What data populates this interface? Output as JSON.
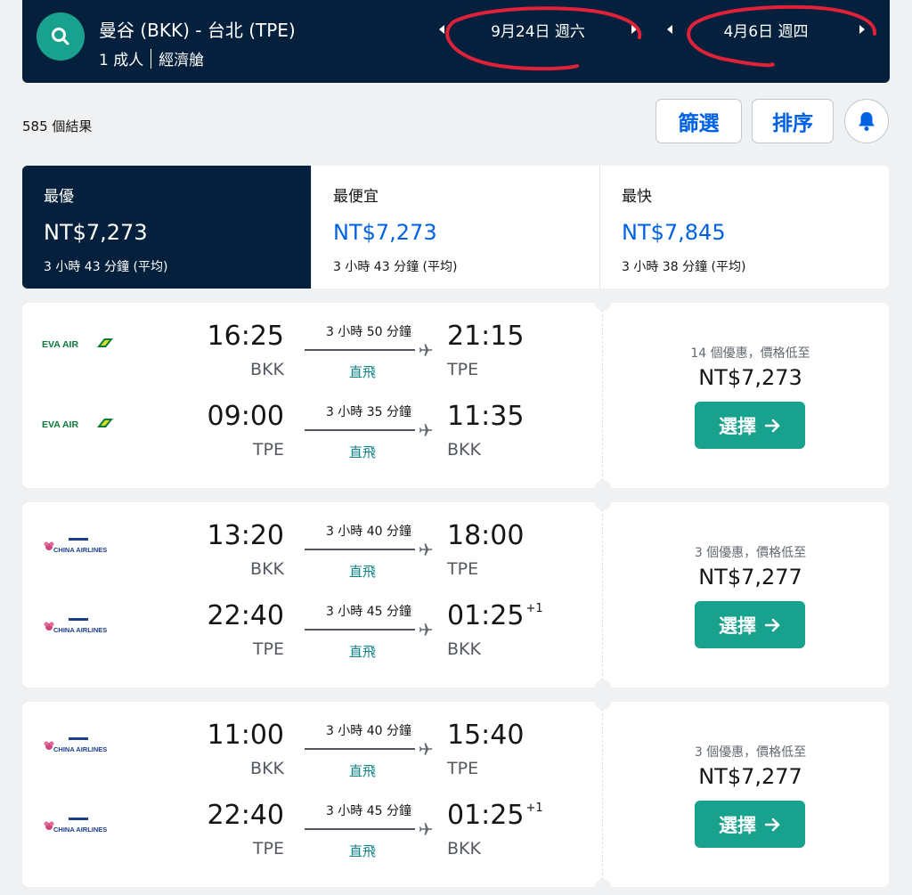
{
  "header": {
    "route": "曼谷 (BKK) - 台北 (TPE)",
    "passengers": "1 成人",
    "cabin": "經濟艙",
    "depart_date": "9月24日 週六",
    "return_date": "4月6日 週四"
  },
  "toolbar": {
    "result_count": "585 個結果",
    "filter_label": "篩選",
    "sort_label": "排序"
  },
  "summary": [
    {
      "title": "最優",
      "price": "NT$7,273",
      "duration": "3 小時 43 分鐘 (平均)"
    },
    {
      "title": "最便宜",
      "price": "NT$7,273",
      "duration": "3 小時 43 分鐘 (平均)"
    },
    {
      "title": "最快",
      "price": "NT$7,845",
      "duration": "3 小時 38 分鐘 (平均)"
    }
  ],
  "results": [
    {
      "legs": [
        {
          "airline": "EVA AIR",
          "dep_time": "16:25",
          "dep_code": "BKK",
          "duration": "3 小時 50 分鐘",
          "stops": "直飛",
          "arr_time": "21:15",
          "arr_code": "TPE",
          "day_offset": ""
        },
        {
          "airline": "EVA AIR",
          "dep_time": "09:00",
          "dep_code": "TPE",
          "duration": "3 小時 35 分鐘",
          "stops": "直飛",
          "arr_time": "11:35",
          "arr_code": "BKK",
          "day_offset": ""
        }
      ],
      "deals": "14 個優惠，價格低至",
      "price": "NT$7,273",
      "select_label": "選擇"
    },
    {
      "legs": [
        {
          "airline": "CHINA AIRLINES",
          "dep_time": "13:20",
          "dep_code": "BKK",
          "duration": "3 小時 40 分鐘",
          "stops": "直飛",
          "arr_time": "18:00",
          "arr_code": "TPE",
          "day_offset": ""
        },
        {
          "airline": "CHINA AIRLINES",
          "dep_time": "22:40",
          "dep_code": "TPE",
          "duration": "3 小時 45 分鐘",
          "stops": "直飛",
          "arr_time": "01:25",
          "arr_code": "BKK",
          "day_offset": "+1"
        }
      ],
      "deals": "3 個優惠，價格低至",
      "price": "NT$7,277",
      "select_label": "選擇"
    },
    {
      "legs": [
        {
          "airline": "CHINA AIRLINES",
          "dep_time": "11:00",
          "dep_code": "BKK",
          "duration": "3 小時 40 分鐘",
          "stops": "直飛",
          "arr_time": "15:40",
          "arr_code": "TPE",
          "day_offset": ""
        },
        {
          "airline": "CHINA AIRLINES",
          "dep_time": "22:40",
          "dep_code": "TPE",
          "duration": "3 小時 45 分鐘",
          "stops": "直飛",
          "arr_time": "01:25",
          "arr_code": "BKK",
          "day_offset": "+1"
        }
      ],
      "deals": "3 個優惠，價格低至",
      "price": "NT$7,277",
      "select_label": "選擇"
    }
  ],
  "icons": {
    "search": "search-icon",
    "bell": "bell-icon",
    "plane": "plane-icon",
    "arrow": "arrow-right-icon",
    "eva_logo": "eva-air-logo",
    "ci_logo": "china-airlines-logo"
  },
  "colors": {
    "header_bg": "#05203c",
    "accent_teal": "#18a28e",
    "link_blue": "#0062e3",
    "annotation_red": "#e0213a"
  }
}
